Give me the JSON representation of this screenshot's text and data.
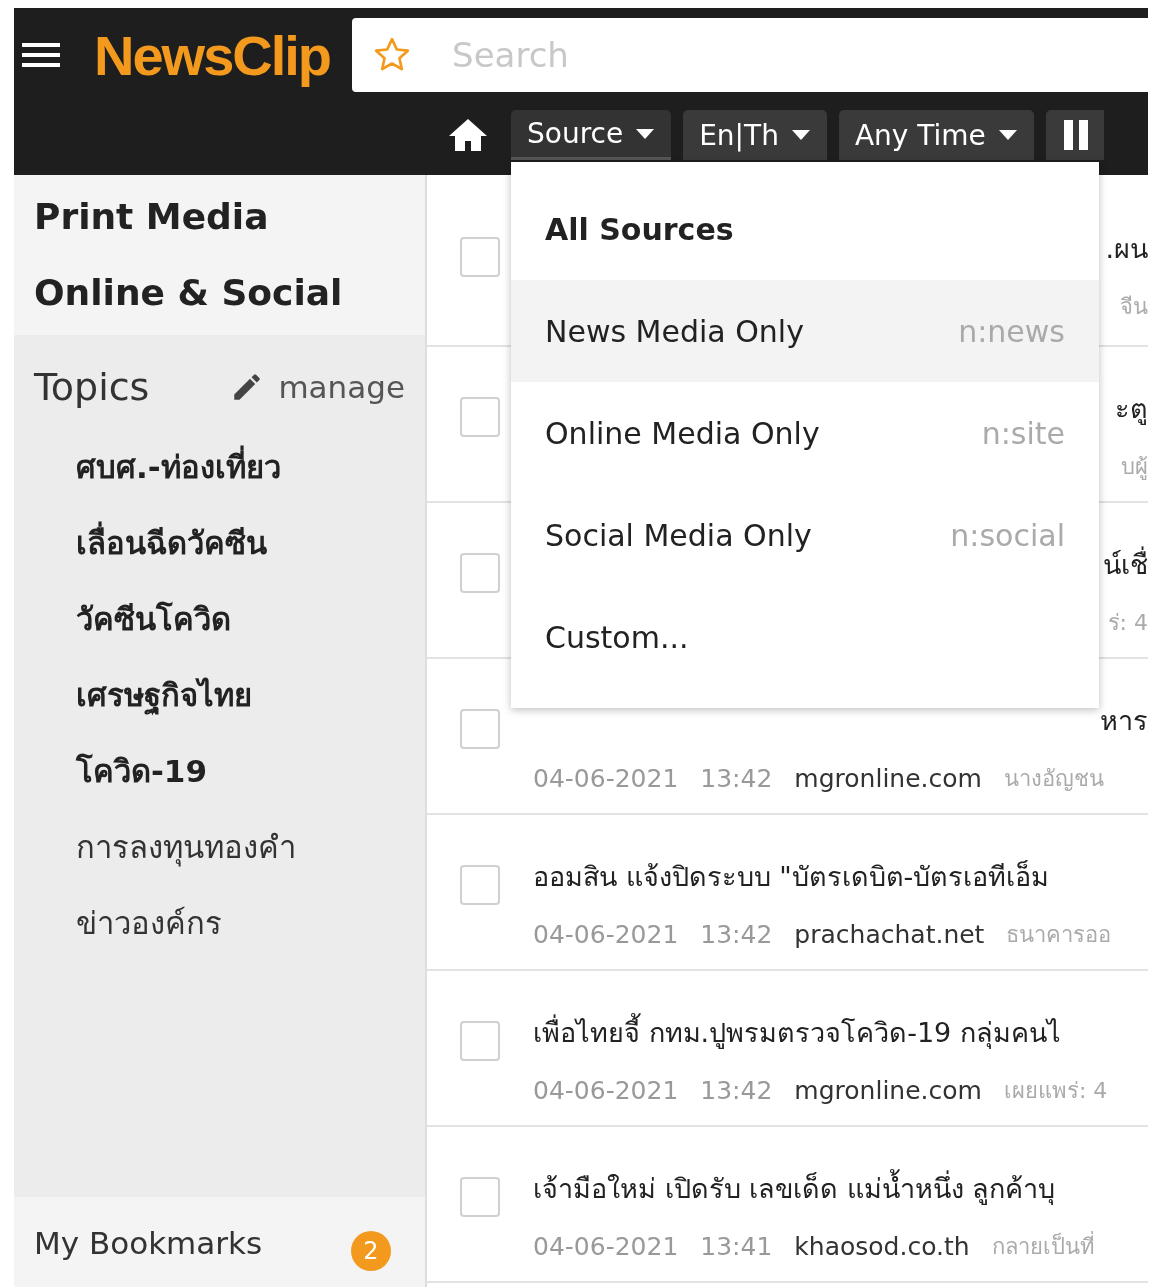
{
  "header": {
    "logo": "NewsClip",
    "search": {
      "placeholder": "Search"
    },
    "filters": [
      {
        "label": "Source",
        "expanded": true
      },
      {
        "label": "En|Th",
        "expanded": false
      },
      {
        "label": "Any Time",
        "expanded": false
      }
    ]
  },
  "sidebar": {
    "sections": [
      "Print Media",
      "Online & Social"
    ],
    "topics_title": "Topics",
    "manage": "manage",
    "topics": [
      {
        "label": "ศบศ.-ท่องเที่ยว",
        "unread": true
      },
      {
        "label": "เลื่อนฉีดวัคซีน",
        "unread": true
      },
      {
        "label": "วัคซีนโควิด",
        "unread": true
      },
      {
        "label": "เศรษฐกิจไทย",
        "unread": true
      },
      {
        "label": "โควิด-19",
        "unread": true
      },
      {
        "label": "การลงทุนทองคำ",
        "unread": false
      },
      {
        "label": "ข่าวองค์กร",
        "unread": false
      }
    ],
    "bookmarks": {
      "label": "My Bookmarks",
      "count": "2"
    }
  },
  "source_menu": [
    {
      "label": "All Sources",
      "selected": true,
      "highlighted": false
    },
    {
      "label": "News Media Only",
      "shortcut": "n:news",
      "selected": false,
      "highlighted": true
    },
    {
      "label": "Online Media Only",
      "shortcut": "n:site",
      "selected": false,
      "highlighted": false
    },
    {
      "label": "Social Media Only",
      "shortcut": "n:social",
      "selected": false,
      "highlighted": false
    },
    {
      "label": "Custom...",
      "selected": false,
      "highlighted": false
    }
  ],
  "articles": [
    {
      "kind": "covered",
      "title": ".ผน",
      "snippet": "จีน",
      "checked": false
    },
    {
      "kind": "covered",
      "title": "ะตู",
      "snippet": "บผู้",
      "checked": false
    },
    {
      "kind": "covered",
      "title": "น์เชื่",
      "snippet": "ร่: 4",
      "checked": false
    },
    {
      "kind": "partial",
      "title": "หาร",
      "date": "04-06-2021",
      "time": "13:42",
      "source": "mgronline.com",
      "snippet": "นางอัญชน",
      "checked": false
    },
    {
      "kind": "full",
      "title": "ออมสิน แจ้งปิดระบบ \"บัตรเดบิต-บัตรเอทีเอ็ม",
      "date": "04-06-2021",
      "time": "13:42",
      "source": "prachachat.net",
      "snippet": "ธนาคารออ",
      "checked": false
    },
    {
      "kind": "full",
      "title": "เพื่อไทยจี้ กทม.ปูพรมตรวจโควิด-19 กลุ่มคนไ",
      "date": "04-06-2021",
      "time": "13:42",
      "source": "mgronline.com",
      "snippet": "เผยแพร่: 4",
      "checked": false
    },
    {
      "kind": "full",
      "title": "เจ้ามือใหม่ เปิดรับ เลขเด็ด แม่น้ำหนึ่ง ลูกค้าบุ",
      "date": "04-06-2021",
      "time": "13:41",
      "source": "khaosod.co.th",
      "snippet": "กลายเป็นที่",
      "checked": false
    }
  ]
}
